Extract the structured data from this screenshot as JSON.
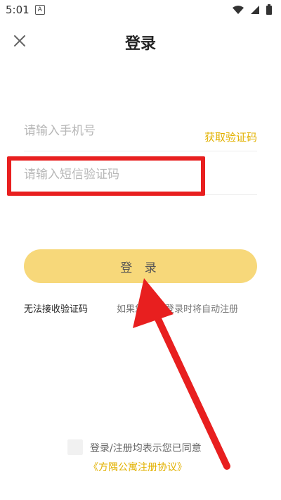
{
  "status_bar": {
    "time": "5:01",
    "badge_label": "A"
  },
  "header": {
    "title": "登录"
  },
  "form": {
    "phone_placeholder": "请输入手机号",
    "get_code_label": "获取验证码",
    "code_placeholder": "请输入短信验证码"
  },
  "actions": {
    "login_label": "登 录",
    "cannot_receive_label": "无法接收验证码",
    "auto_register_note": "如果您 册，登录时将自动注册"
  },
  "agreement": {
    "text": "登录/注册均表示您已同意",
    "link": "《方隅公寓注册协议》"
  },
  "colors": {
    "accent": "#e2b100",
    "button_bg": "#f7d87a",
    "annotation_red": "#e81f1f"
  }
}
